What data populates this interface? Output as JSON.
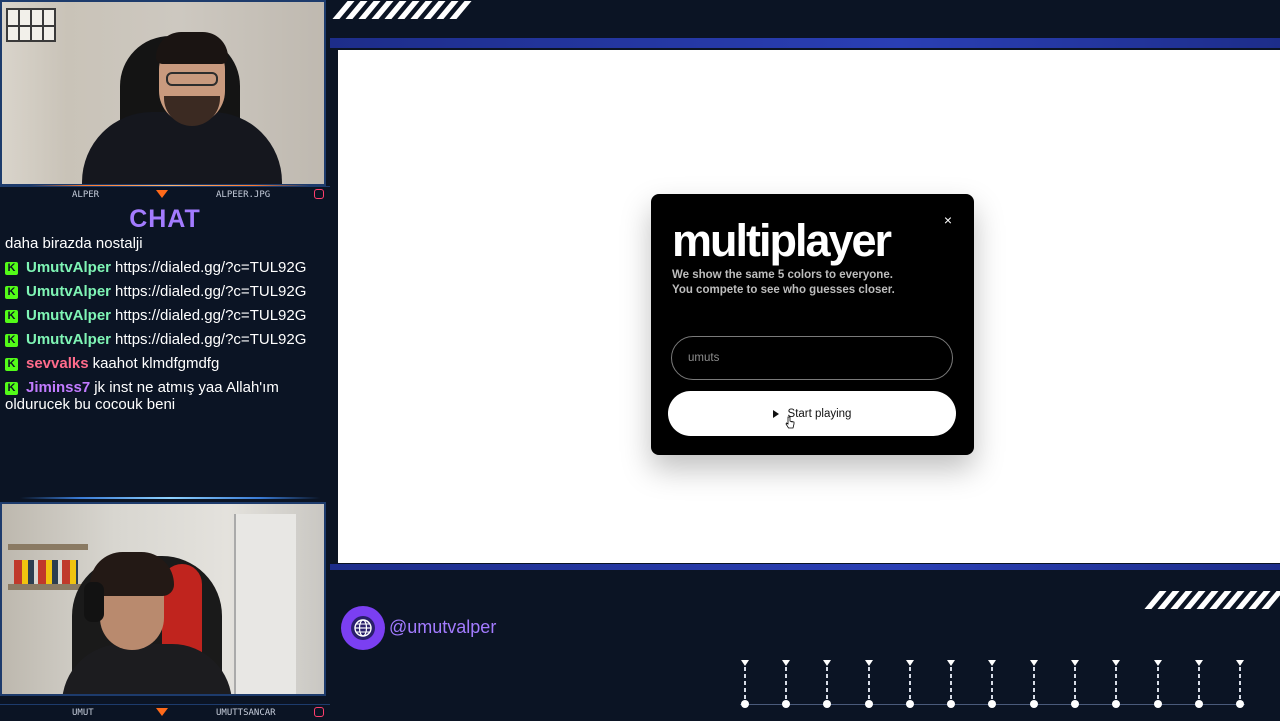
{
  "webcam_top": {
    "left_name": "ALPER",
    "right_name": "ALPEER.JPG"
  },
  "webcam_bottom": {
    "left_name": "UMUT",
    "right_name": "UMUTTSANCAR"
  },
  "chat": {
    "title": "CHAT",
    "messages": [
      {
        "user": "",
        "user_color": "",
        "badge": false,
        "text": "daha birazda nostalji"
      },
      {
        "user": "UmutvAlper",
        "user_color": "#7ff5b5",
        "badge": true,
        "text": "https://dialed.gg/?c=TUL92G"
      },
      {
        "user": "UmutvAlper",
        "user_color": "#7ff5b5",
        "badge": true,
        "text": "https://dialed.gg/?c=TUL92G"
      },
      {
        "user": "UmutvAlper",
        "user_color": "#7ff5b5",
        "badge": true,
        "text": "https://dialed.gg/?c=TUL92G"
      },
      {
        "user": "UmutvAlper",
        "user_color": "#7ff5b5",
        "badge": true,
        "text": "https://dialed.gg/?c=TUL92G"
      },
      {
        "user": "sevvalks",
        "user_color": "#ff6b8b",
        "badge": true,
        "text": "kaahot klmdfgmdfg"
      },
      {
        "user": "Jiminss7",
        "user_color": "#c27bff",
        "badge": true,
        "text": "jk inst ne atmış yaa Allah'ım oldurucek bu cocouk beni"
      }
    ],
    "badge_letter": "K",
    "badge_color": "#53fc18"
  },
  "modal": {
    "title": "multiplayer",
    "description_line1": "We show the same 5 colors to everyone.",
    "description_line2": "You compete to see who guesses closer.",
    "name_input": {
      "value": "",
      "placeholder": "umuts"
    },
    "start_button_label": "Start playing",
    "close_label": "×"
  },
  "footer": {
    "handle": "@umutvalper",
    "accent_color": "#7b3ff2"
  },
  "icons": {
    "close": "close-icon",
    "play": "play-icon",
    "globe": "globe-icon",
    "instagram": "instagram-icon",
    "kick_badge": "kick-badge-icon",
    "cursor": "hand-cursor-icon"
  }
}
